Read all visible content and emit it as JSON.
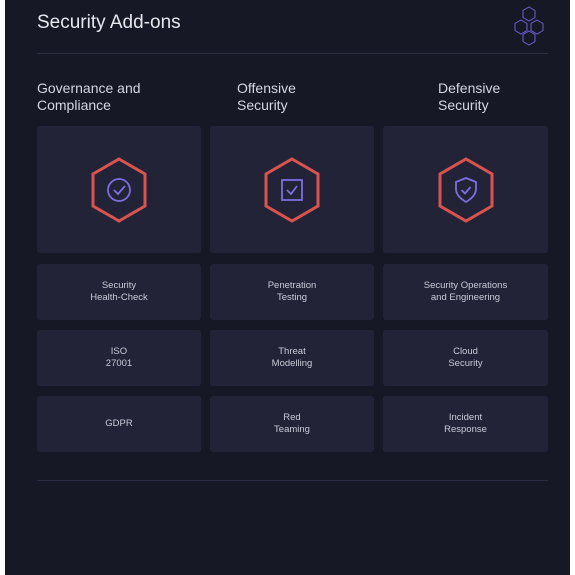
{
  "header": {
    "title": "Security Add-ons",
    "logo_icon": "hex-cluster-logo-icon"
  },
  "colors": {
    "background": "#171826",
    "card": "#222337",
    "hex_accent": "#d9534f",
    "icon_accent": "#7b6fe0"
  },
  "columns": [
    {
      "heading": "Governance and\nCompliance",
      "icon": "check-circle-icon",
      "items": [
        "Security\nHealth-Check",
        "ISO\n27001",
        "GDPR"
      ]
    },
    {
      "heading": "Offensive\nSecurity",
      "icon": "check-square-icon",
      "items": [
        "Penetration\nTesting",
        "Threat\nModelling",
        "Red\nTeaming"
      ]
    },
    {
      "heading": "Defensive\nSecurity",
      "icon": "shield-check-icon",
      "items": [
        "Security Operations\nand Engineering",
        "Cloud\nSecurity",
        "Incident\nResponse"
      ]
    }
  ]
}
